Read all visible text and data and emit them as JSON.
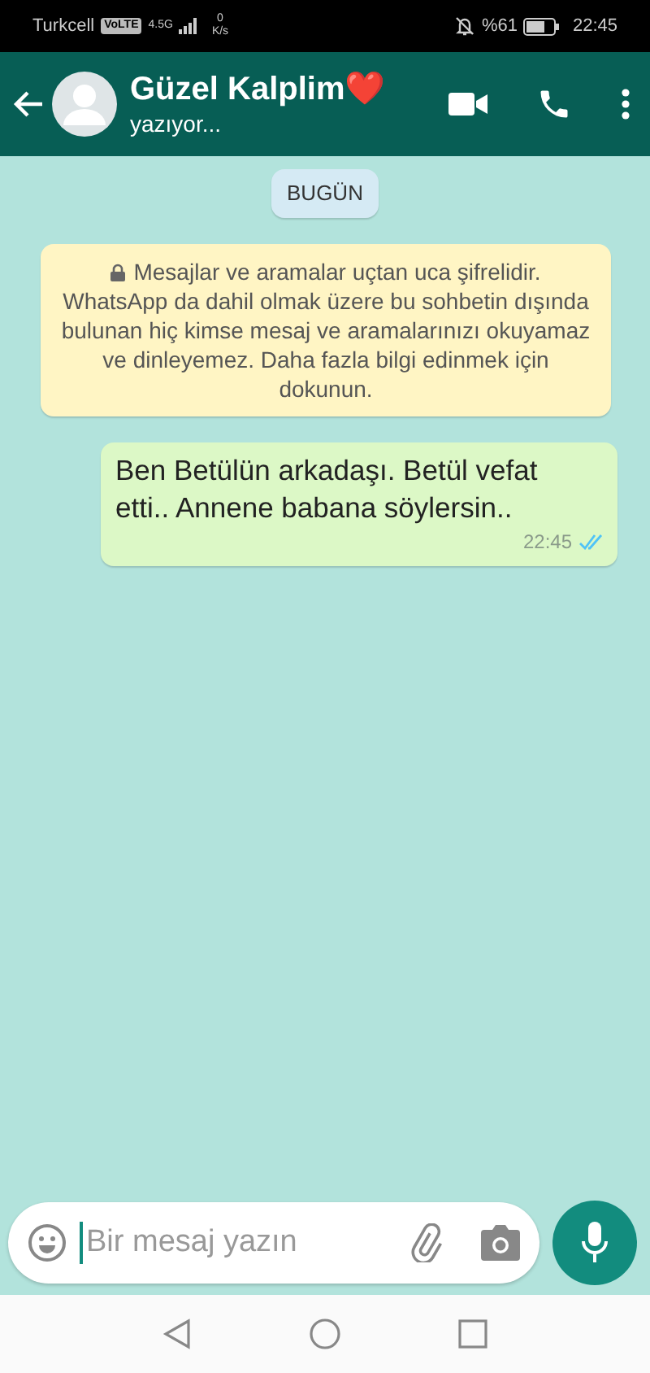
{
  "status_bar": {
    "carrier": "Turkcell",
    "volte": "VoLTE",
    "network": "4.5G",
    "speed_value": "0",
    "speed_unit": "K/s",
    "battery": "%61",
    "time": "22:45"
  },
  "header": {
    "title": "Güzel Kalplim❤️",
    "subtitle": "yazıyor..."
  },
  "date_chip": "BUGÜN",
  "encryption_notice": "Mesajlar ve aramalar uçtan uca şifrelidir. WhatsApp da dahil olmak üzere bu sohbetin dışında bulunan hiç kimse mesaj ve aramalarınızı okuyamaz ve dinleyemez. Daha fazla bilgi edinmek için dokunun.",
  "messages": [
    {
      "text": "Ben Betülün arkadaşı. Betül vefat etti.. Annene babana söylersin..",
      "time": "22:45",
      "read": true
    }
  ],
  "composer": {
    "placeholder": "Bir mesaj yazın"
  }
}
